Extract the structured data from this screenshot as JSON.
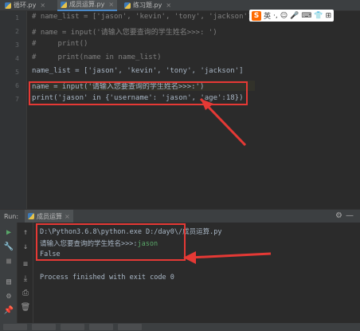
{
  "tabs": [
    {
      "label": "循环.py",
      "active": false
    },
    {
      "label": "成员运算.py",
      "active": true
    },
    {
      "label": "练习题.py",
      "active": false
    }
  ],
  "editor": {
    "line_numbers": [
      "1",
      "2",
      "3",
      "4",
      "5",
      "6",
      "7"
    ],
    "lines": [
      "# name_list = ['jason', 'kevin', 'tony', 'jackson']",
      "# name = input('请输入您要查询的学生姓名>>>: ')",
      "#     print()",
      "#     print(name in name_list)",
      "name_list = ['jason', 'kevin', 'tony', 'jackson']",
      "name = input('请输入您要查询的学生姓名>>>:')",
      "print('jason' in {'username': 'jason', 'age':18})"
    ]
  },
  "ime": {
    "logo": "S",
    "items": [
      "英",
      "·,",
      "☺",
      "🎤",
      "⌨",
      "👕",
      "⊞"
    ]
  },
  "run": {
    "panel_label": "Run:",
    "tab_label": "成员运算",
    "output": {
      "cmd": "D:\\Python3.6.8\\python.exe D:/day0\\/成员运算.py",
      "prompt": "请输入您要查询的学生姓名>>>:",
      "input": "jason",
      "result": "False",
      "finished": "Process finished with exit code 0"
    }
  },
  "colors": {
    "accent_red": "#e53935",
    "editor_bg": "#2b2b2b",
    "keyword": "#cc7832",
    "string": "#6a8759",
    "number": "#6897bb",
    "comment": "#808080"
  }
}
